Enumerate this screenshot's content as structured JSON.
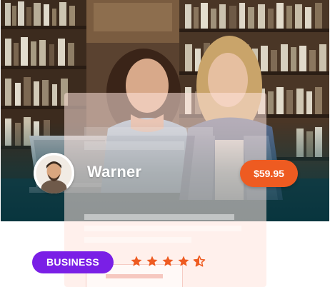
{
  "course": {
    "instructor": {
      "name": "Warner",
      "avatar_icon": "person-avatar-icon"
    },
    "price": "$59.95",
    "category": "BUSINESS",
    "rating": {
      "value": 4.5,
      "max": 5,
      "filled_star_color": "#ee5b21"
    }
  },
  "colors": {
    "price_badge": "#ee5b21",
    "category_badge": "#7a1fe6",
    "overlay_teal": "#063c46"
  }
}
